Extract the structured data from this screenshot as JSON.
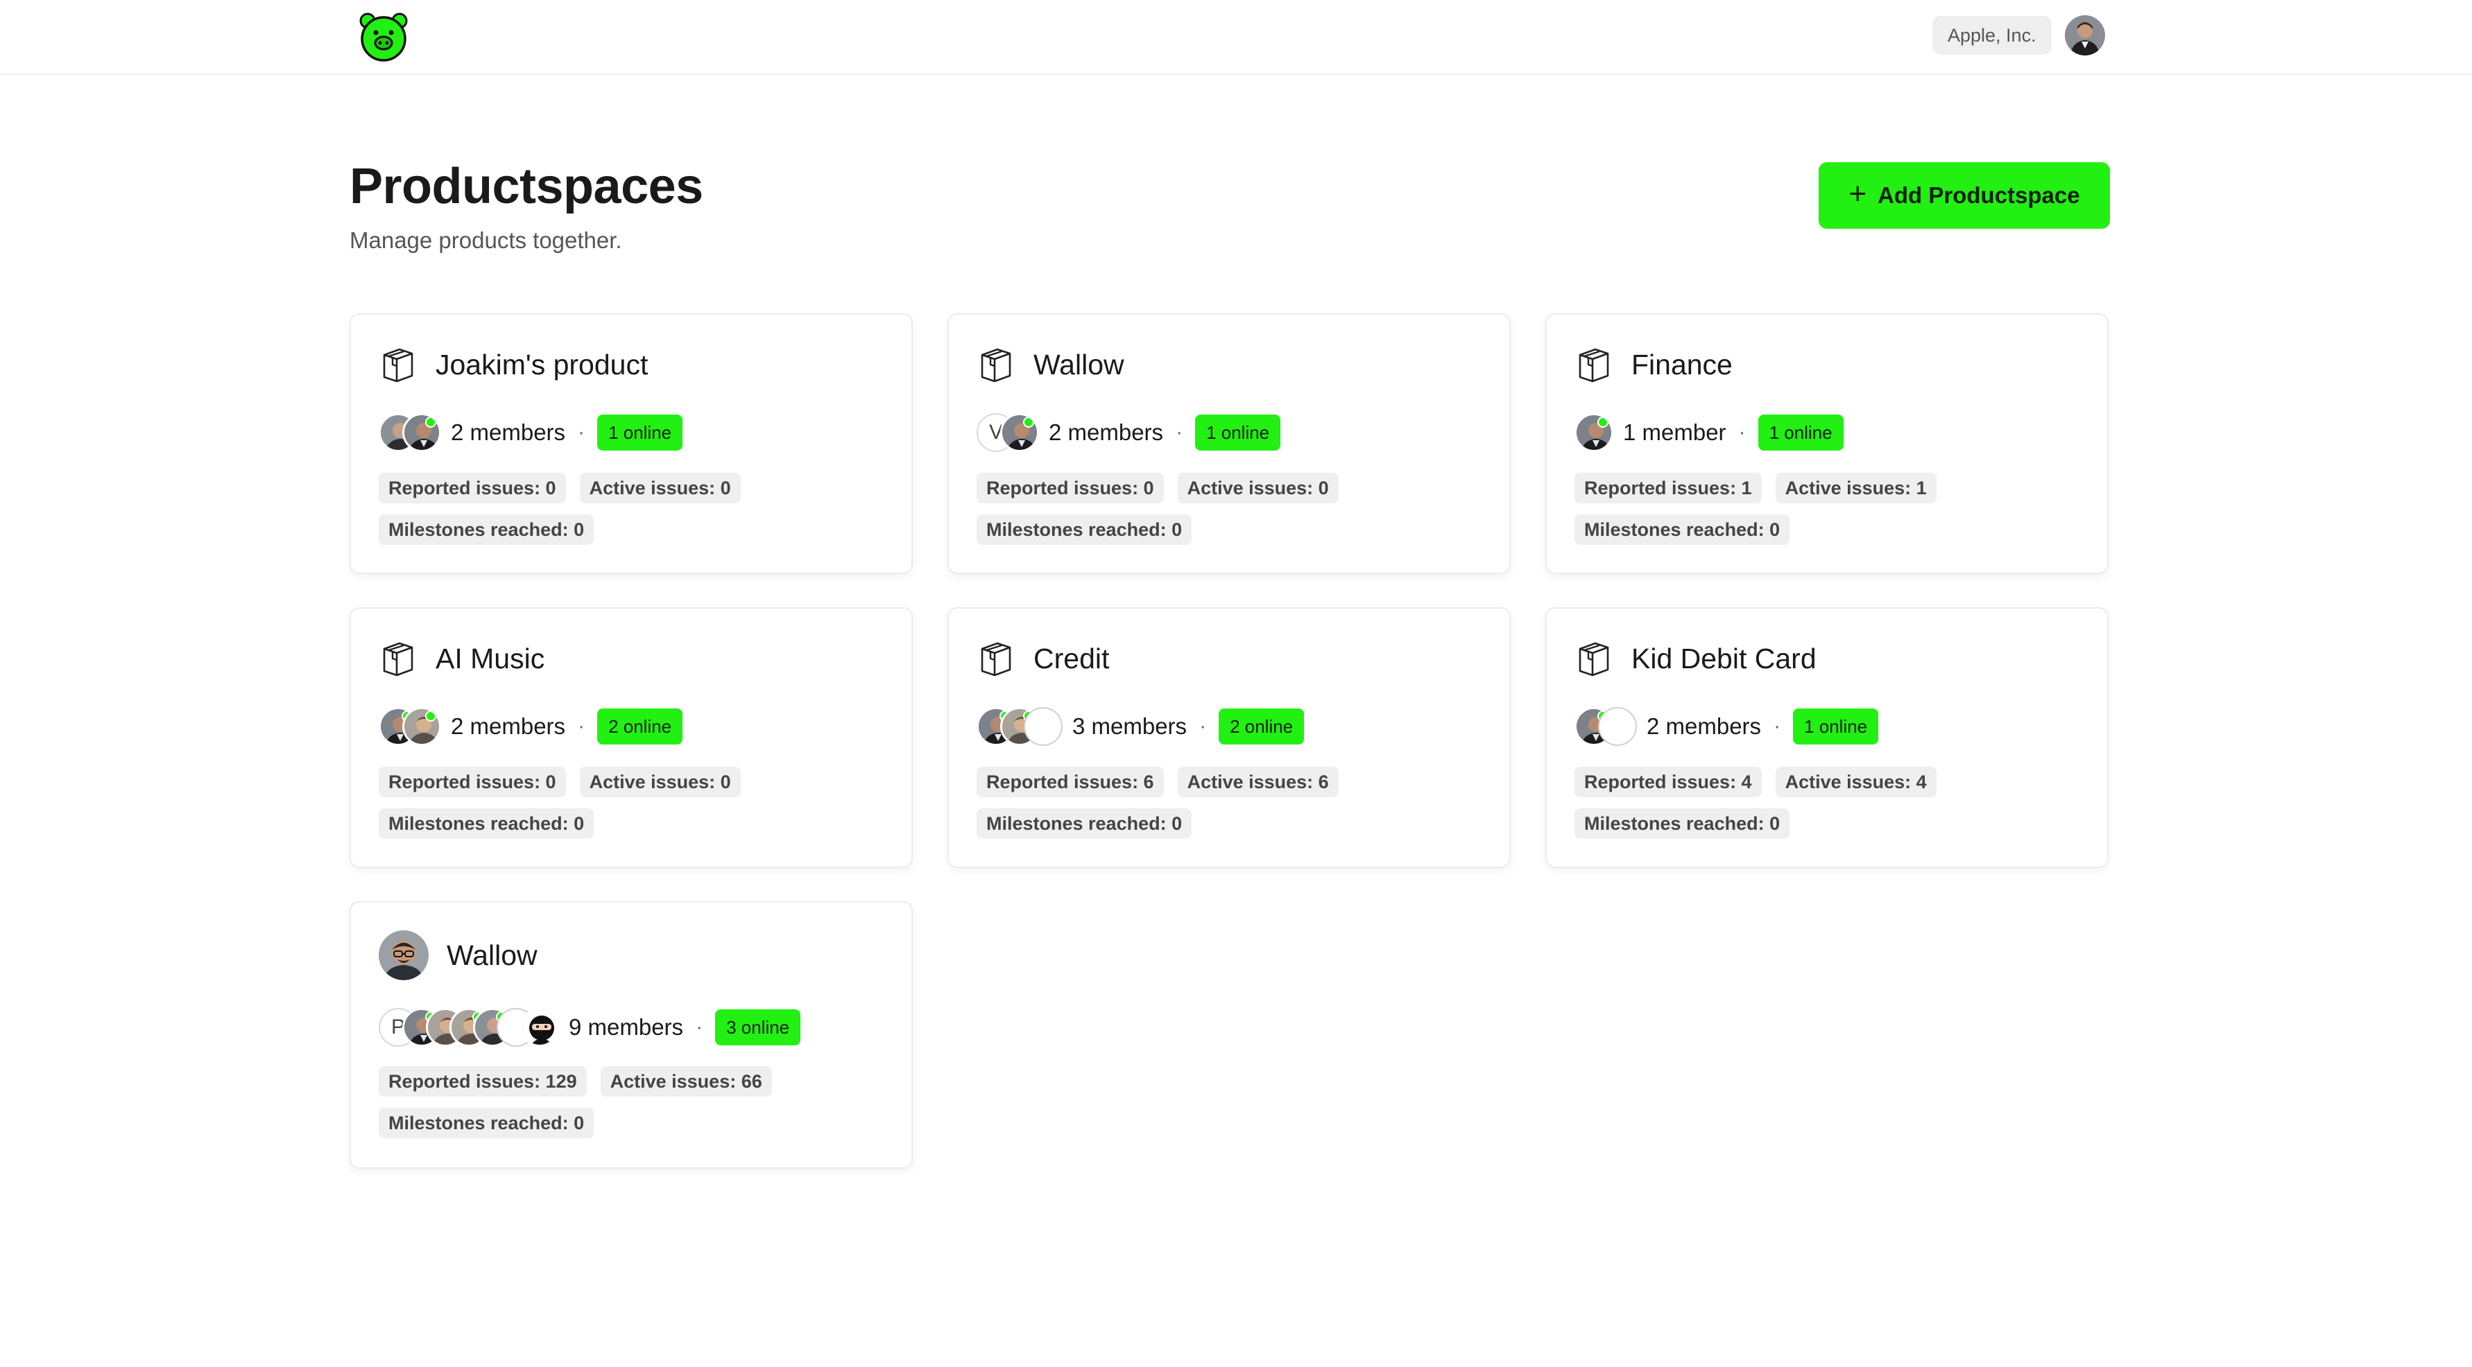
{
  "header": {
    "org_name": "Apple, Inc."
  },
  "page": {
    "title": "Productspaces",
    "subtitle": "Manage products together.",
    "add_button_label": "Add Productspace"
  },
  "colors": {
    "accent": "#22f012",
    "card_border": "#ececec",
    "chip_bg": "#efefef"
  },
  "cards": [
    {
      "title": "Joakim's product",
      "icon": "box-icon",
      "members_label": "2 members",
      "online_label": "1 online",
      "reported": "Reported issues: 0",
      "active": "Active issues: 0",
      "milestones": "Milestones reached: 0"
    },
    {
      "title": "Wallow",
      "icon": "box-icon",
      "avatar_letter": "V",
      "members_label": "2 members",
      "online_label": "1 online",
      "reported": "Reported issues: 0",
      "active": "Active issues: 0",
      "milestones": "Milestones reached: 0"
    },
    {
      "title": "Finance",
      "icon": "box-icon",
      "members_label": "1 member",
      "online_label": "1 online",
      "reported": "Reported issues: 1",
      "active": "Active issues: 1",
      "milestones": "Milestones reached: 0"
    },
    {
      "title": "AI Music",
      "icon": "box-icon",
      "members_label": "2 members",
      "online_label": "2 online",
      "reported": "Reported issues: 0",
      "active": "Active issues: 0",
      "milestones": "Milestones reached: 0"
    },
    {
      "title": "Credit",
      "icon": "box-icon",
      "members_label": "3 members",
      "online_label": "2 online",
      "reported": "Reported issues: 6",
      "active": "Active issues: 6",
      "milestones": "Milestones reached: 0"
    },
    {
      "title": "Kid Debit Card",
      "icon": "box-icon",
      "members_label": "2 members",
      "online_label": "1 online",
      "reported": "Reported issues: 4",
      "active": "Active issues: 4",
      "milestones": "Milestones reached: 0"
    },
    {
      "title": "Wallow",
      "icon": "face-icon",
      "avatar_letter": "P",
      "members_label": "9 members",
      "online_label": "3 online",
      "reported": "Reported issues: 129",
      "active": "Active issues: 66",
      "milestones": "Milestones reached: 0"
    }
  ]
}
